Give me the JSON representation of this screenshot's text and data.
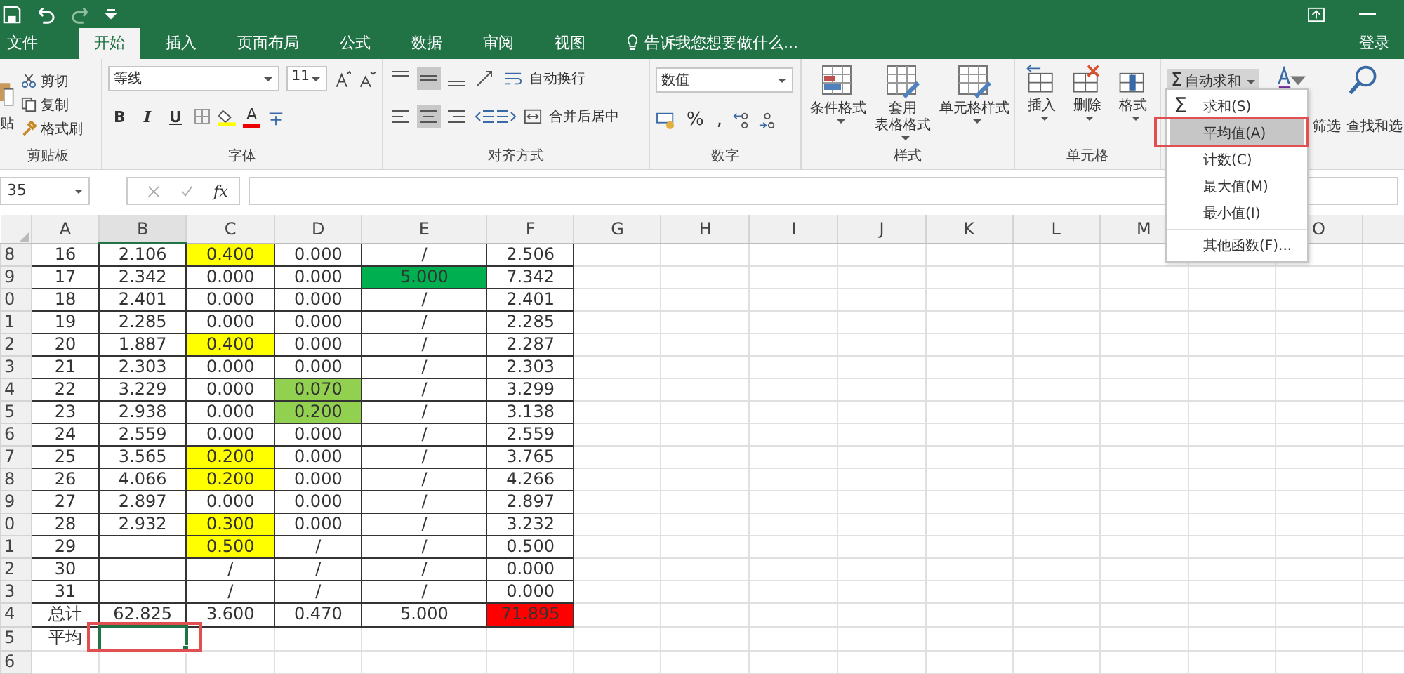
{
  "tabs": [
    {
      "label": "文件",
      "selected": false
    },
    {
      "label": "开始",
      "selected": true
    },
    {
      "label": "插入",
      "selected": false
    },
    {
      "label": "页面布局",
      "selected": false
    },
    {
      "label": "公式",
      "selected": false
    },
    {
      "label": "数据",
      "selected": false
    },
    {
      "label": "审阅",
      "selected": false
    },
    {
      "label": "视图",
      "selected": false
    }
  ],
  "tell_me": "告诉我您想要做什么...",
  "sign_in": "登录",
  "clipboard": {
    "paste": "贴",
    "items": [
      "剪切",
      "复制",
      "格式刷"
    ],
    "label": "剪贴板"
  },
  "font": {
    "name": "等线",
    "size": "11",
    "styles": [
      "B",
      "I",
      "U"
    ],
    "color_letter": "A",
    "label": "字体"
  },
  "alignment": {
    "wrap": "自动换行",
    "merge": "合并后居中",
    "label": "对齐方式"
  },
  "number": {
    "format": "数值",
    "percent": "%",
    "comma": ",",
    "label": "数字"
  },
  "styles": {
    "buttons": [
      [
        "条件格式"
      ],
      [
        "套用",
        "表格格式"
      ],
      [
        "单元格样式"
      ]
    ],
    "label": "样式"
  },
  "cells": {
    "buttons": [
      "插入",
      "删除",
      "格式"
    ],
    "label": "单元格"
  },
  "editing": {
    "autosum_icon": "Σ",
    "autosum": "自动求和",
    "expanded": true,
    "sort": "筛选",
    "find": "查找和选"
  },
  "autosum_menu": [
    {
      "icon": "Σ",
      "label": "求和(S)",
      "selected": false
    },
    {
      "label": "平均值(A)",
      "selected": true
    },
    {
      "label": "计数(C)",
      "selected": false
    },
    {
      "label": "最大值(M)",
      "selected": false
    },
    {
      "label": "最小值(I)",
      "selected": false
    },
    {
      "label": "其他函数(F)...",
      "selected": false
    }
  ],
  "name_box": "35",
  "fx": "fx",
  "columns": [
    {
      "label": "A"
    },
    {
      "label": "B"
    },
    {
      "label": "C"
    },
    {
      "label": "D"
    },
    {
      "label": "E"
    },
    {
      "label": "F"
    },
    {
      "label": "G"
    },
    {
      "label": "H"
    },
    {
      "label": "I"
    },
    {
      "label": "J"
    },
    {
      "label": "K"
    },
    {
      "label": "L"
    },
    {
      "label": "M"
    },
    {},
    {
      "label": "O"
    },
    {}
  ],
  "rows": [
    {
      "header": "8",
      "cells": [
        "16",
        "2.106",
        {
          "text": "0.400",
          "color": "#ffff00"
        },
        "0.000",
        "/",
        "2.506"
      ]
    },
    {
      "header": "9",
      "cells": [
        "17",
        "2.342",
        "0.000",
        "0.000",
        {
          "text": "5.000",
          "color": "#00b050"
        },
        "7.342"
      ]
    },
    {
      "header": "0",
      "cells": [
        "18",
        "2.401",
        "0.000",
        "0.000",
        "/",
        "2.401"
      ]
    },
    {
      "header": "1",
      "cells": [
        "19",
        "2.285",
        "0.000",
        "0.000",
        "/",
        "2.285"
      ]
    },
    {
      "header": "2",
      "cells": [
        "20",
        "1.887",
        {
          "text": "0.400",
          "color": "#ffff00"
        },
        "0.000",
        "/",
        "2.287"
      ]
    },
    {
      "header": "3",
      "cells": [
        "21",
        "2.303",
        "0.000",
        "0.000",
        "/",
        "2.303"
      ]
    },
    {
      "header": "4",
      "cells": [
        "22",
        "3.229",
        "0.000",
        {
          "text": "0.070",
          "color": "#92d050"
        },
        "/",
        "3.299"
      ]
    },
    {
      "header": "5",
      "cells": [
        "23",
        "2.938",
        "0.000",
        {
          "text": "0.200",
          "color": "#92d050"
        },
        "/",
        "3.138"
      ]
    },
    {
      "header": "6",
      "cells": [
        "24",
        "2.559",
        "0.000",
        "0.000",
        "/",
        "2.559"
      ]
    },
    {
      "header": "7",
      "cells": [
        "25",
        "3.565",
        {
          "text": "0.200",
          "color": "#ffff00"
        },
        "0.000",
        "/",
        "3.765"
      ]
    },
    {
      "header": "8",
      "cells": [
        "26",
        "4.066",
        {
          "text": "0.200",
          "color": "#ffff00"
        },
        "0.000",
        "/",
        "4.266"
      ]
    },
    {
      "header": "9",
      "cells": [
        "27",
        "2.897",
        "0.000",
        "0.000",
        "/",
        "2.897"
      ]
    },
    {
      "header": "0",
      "cells": [
        "28",
        "2.932",
        {
          "text": "0.300",
          "color": "#ffff00"
        },
        "0.000",
        "/",
        "3.232"
      ]
    },
    {
      "header": "1",
      "cells": [
        "29",
        null,
        {
          "text": "0.500",
          "color": "#ffff00"
        },
        "/",
        "/",
        "0.500"
      ]
    },
    {
      "header": "2",
      "cells": [
        "30",
        null,
        "/",
        "/",
        "/",
        "0.000"
      ]
    },
    {
      "header": "3",
      "cells": [
        "31",
        null,
        "/",
        "/",
        "/",
        "0.000"
      ]
    },
    {
      "header": "4",
      "cells": [
        "总计",
        "62.825",
        "3.600",
        "0.470",
        "5.000",
        {
          "text": "71.895",
          "color": "#ff0000"
        }
      ]
    },
    {
      "header": "5",
      "cells": [
        "平均",
        {
          "selected": true
        }
      ]
    },
    {
      "header": "6",
      "cells": []
    }
  ]
}
